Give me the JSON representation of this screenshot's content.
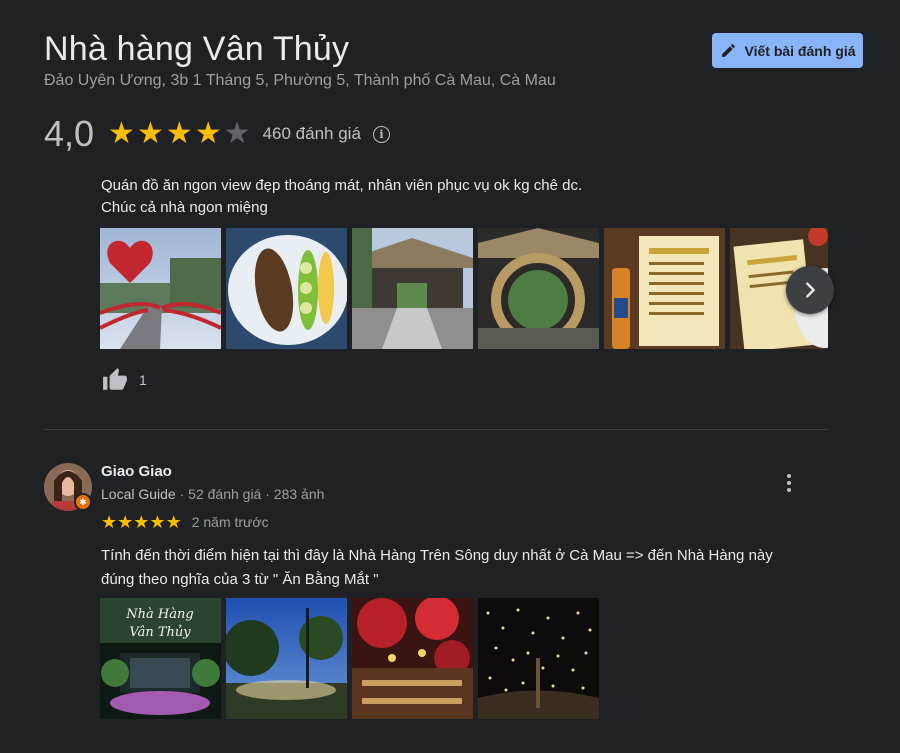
{
  "place": {
    "title": "Nhà hàng Vân Thủy",
    "address": "Đảo Uyên Ương, 3b 1 Tháng 5, Phường 5, Thành phố Cà Mau, Cà Mau",
    "write_review_label": "Viết bài đánh giá"
  },
  "rating": {
    "value": "4,0",
    "stars": 4,
    "review_count": "460 đánh giá",
    "info_glyph": "i"
  },
  "review1": {
    "text_lines": [
      "Quán đồ ăn ngon view đẹp thoáng mát, nhân viên phục vụ ok kg chê dc.",
      "Chúc cả nhà ngon miệng"
    ],
    "photos": [
      "photo-heart-bridge",
      "photo-grilled-fish",
      "photo-thatched-pavilion",
      "photo-bamboo-gate",
      "photo-menu-beer",
      "photo-menu-food"
    ],
    "like_count": "1"
  },
  "review2": {
    "reviewer_name": "Giao Giao",
    "reviewer_guide": "Local Guide",
    "reviewer_stats": " · 52 đánh giá · 283 ảnh",
    "stars": 5,
    "age": "2 năm trước",
    "text_lines": [
      "Tính đến thời điểm hiện tại thì đây là Nhà Hàng Trên Sông duy nhất ở Cà Mau => đến Nhà Hàng này",
      "đúng theo nghĩa của 3 từ \" Ăn Bằng Mắt \""
    ],
    "photos": [
      "photo-entrance-sign-night",
      "photo-lit-trees-blue-sky",
      "photo-red-lanterns",
      "photo-fairy-lights"
    ]
  },
  "colors": {
    "background": "#202124",
    "accent": "#8ab4f8",
    "star": "#fbbc04",
    "star_empty": "#5f6368",
    "badge": "#e8710a"
  },
  "icons": [
    "pencil-icon",
    "info-icon",
    "chevron-right-icon",
    "thumbs-up-icon",
    "more-vert-icon",
    "local-guide-badge-icon",
    "star-icon"
  ]
}
